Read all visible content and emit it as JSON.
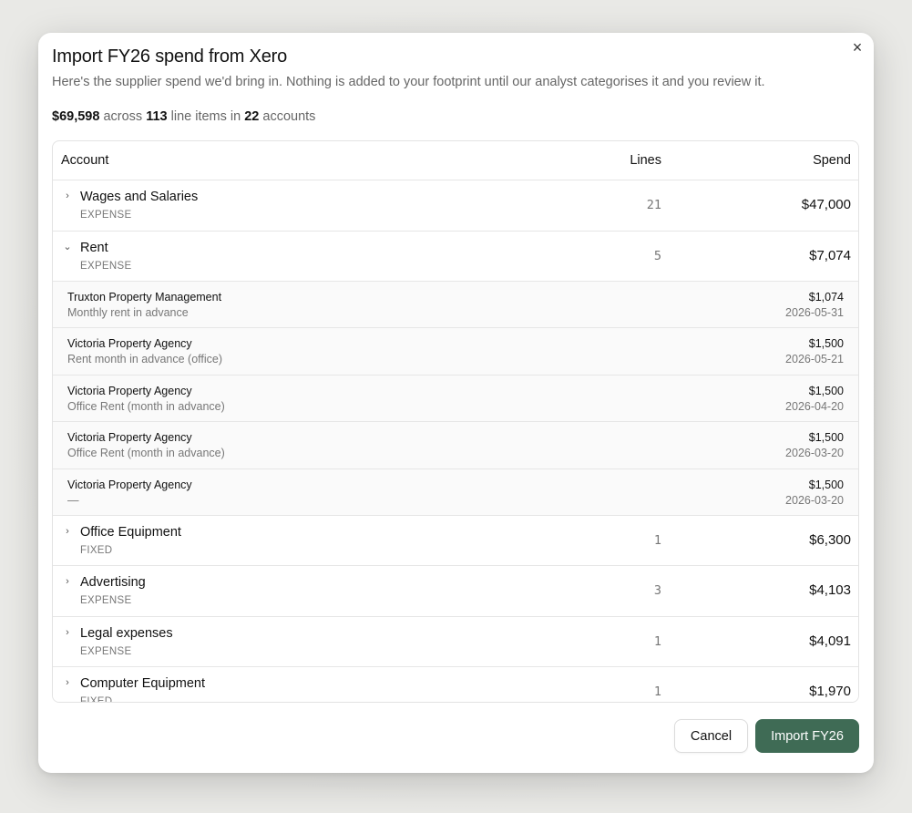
{
  "dialog": {
    "title": "Import FY26 spend from Xero",
    "subtitle": "Here's the supplier spend we'd bring in. Nothing is added to your footprint until our analyst categorises it and you review it.",
    "close_icon": "×"
  },
  "summary": {
    "total": "$69,598",
    "across": " across ",
    "line_count": "113",
    "line_items_in": " line items in ",
    "account_count": "22",
    "accounts": " accounts"
  },
  "table": {
    "headers": {
      "account": "Account",
      "lines": "Lines",
      "spend": "Spend"
    },
    "accounts": [
      {
        "name": "Wages and Salaries",
        "type": "EXPENSE",
        "lines": "21",
        "spend": "$47,000",
        "expanded": false
      },
      {
        "name": "Rent",
        "type": "EXPENSE",
        "lines": "5",
        "spend": "$7,074",
        "expanded": true,
        "items": [
          {
            "supplier": "Truxton Property Management",
            "description": "Monthly rent in advance",
            "amount": "$1,074",
            "date": "2026-05-31"
          },
          {
            "supplier": "Victoria Property Agency",
            "description": "Rent month in advance (office)",
            "amount": "$1,500",
            "date": "2026-05-21"
          },
          {
            "supplier": "Victoria Property Agency",
            "description": "Office Rent (month in advance)",
            "amount": "$1,500",
            "date": "2026-04-20"
          },
          {
            "supplier": "Victoria Property Agency",
            "description": "Office Rent (month in advance)",
            "amount": "$1,500",
            "date": "2026-03-20"
          },
          {
            "supplier": "Victoria Property Agency",
            "description": "—",
            "amount": "$1,500",
            "date": "2026-03-20"
          }
        ]
      },
      {
        "name": "Office Equipment",
        "type": "FIXED",
        "lines": "1",
        "spend": "$6,300",
        "expanded": false
      },
      {
        "name": "Advertising",
        "type": "EXPENSE",
        "lines": "3",
        "spend": "$4,103",
        "expanded": false
      },
      {
        "name": "Legal expenses",
        "type": "EXPENSE",
        "lines": "1",
        "spend": "$4,091",
        "expanded": false
      },
      {
        "name": "Computer Equipment",
        "type": "FIXED",
        "lines": "1",
        "spend": "$1,970",
        "expanded": false
      }
    ]
  },
  "footer": {
    "cancel_label": "Cancel",
    "import_label": "Import FY26"
  },
  "colors": {
    "primary": "#3f6b55",
    "muted_text": "#777777",
    "border": "#e3e3e3"
  }
}
